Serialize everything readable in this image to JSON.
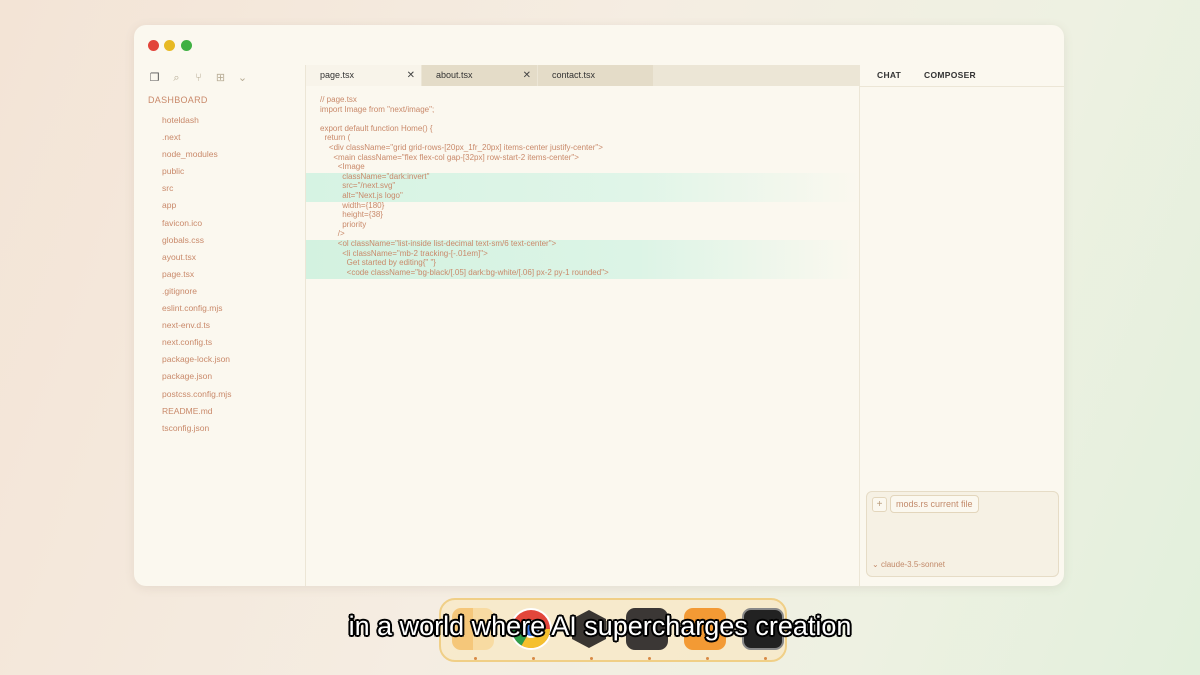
{
  "window": {
    "traffic_lights": {
      "close_color": "#e2443a",
      "minimize_color": "#e7b923",
      "maximize_color": "#3fb043"
    }
  },
  "sidebar": {
    "toolbar_icons": [
      "files-icon",
      "search-icon",
      "source-control-icon",
      "extensions-icon",
      "chevron-down-icon"
    ],
    "root": "DASHBOARD",
    "items": [
      "hoteldash",
      ".next",
      "node_modules",
      "public",
      "src",
      "app",
      "favicon.ico",
      "globals.css",
      "ayout.tsx",
      "page.tsx",
      ".gitignore",
      "eslint.config.mjs",
      "next-env.d.ts",
      "next.config.ts",
      "package-lock.json",
      "package.json",
      "postcss.config.mjs",
      "README.md",
      "tsconfig.json"
    ]
  },
  "tabs": [
    {
      "label": "page.tsx",
      "active": true
    },
    {
      "label": "about.tsx",
      "active": false
    },
    {
      "label": "contact.tsx",
      "active": false
    }
  ],
  "editor": {
    "lines": [
      "// page.tsx",
      "import Image from \"next/image\";",
      "",
      "export default function Home() {",
      "  return (",
      "    <div className=\"grid grid-rows-[20px_1fr_20px] items-center justify-center\">",
      "      <main className=\"flex flex-col gap-[32px] row-start-2 items-center\">",
      "        <Image",
      "          className=\"dark:invert\"",
      "          src=\"/next.svg\"",
      "          alt=\"Next.js logo\"",
      "          width={180}",
      "          height={38}",
      "          priority",
      "        />",
      "        <ol className=\"list-inside list-decimal text-sm/6 text-center\">",
      "          <li className=\"mb-2 tracking-[-.01em]\">",
      "            Get started by editing{\" \"}",
      "            <code className=\"bg-black/[.05] dark:bg-white/[.06] px-2 py-1 rounded\">"
    ],
    "highlight_color": "#d6f3e3"
  },
  "right_panel": {
    "tabs": [
      "CHAT",
      "COMPOSER"
    ],
    "composer": {
      "add_label": "+",
      "context_chip": "mods.rs current file",
      "model": "claude-3.5-sonnet"
    }
  },
  "dock": {
    "apps": [
      "finder-icon",
      "chrome-icon",
      "hexagon-app-icon",
      "terminal-window-icon",
      "orange-app-icon",
      "terminal-icon"
    ]
  },
  "caption": "in a world where AI supercharges creation"
}
